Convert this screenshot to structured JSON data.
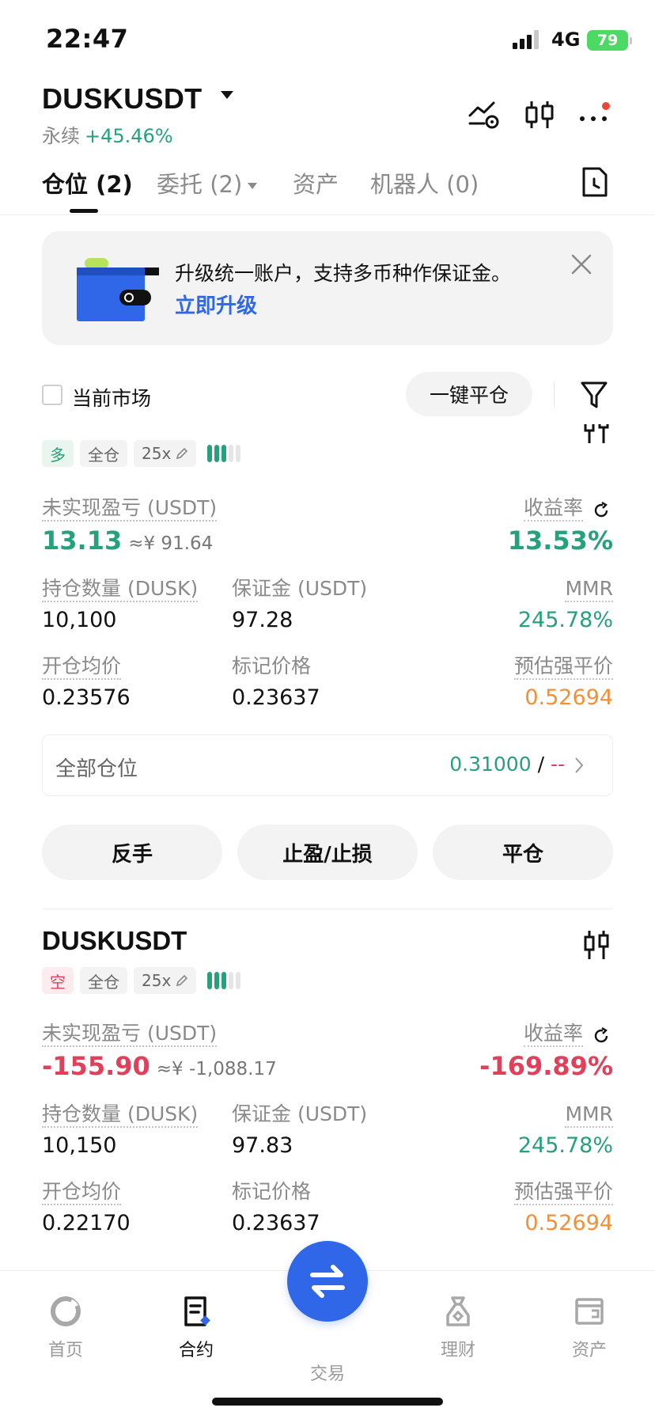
{
  "status_bar": {
    "time": "22:47",
    "network": "4G",
    "battery": "79"
  },
  "header": {
    "pair": "DUSKUSDT",
    "type": "永续",
    "change": "+45.46%"
  },
  "tabs": [
    {
      "label": "仓位 (2)"
    },
    {
      "label": "委托 (2)"
    },
    {
      "label": "资产"
    },
    {
      "label": "机器人 (0)"
    }
  ],
  "banner": {
    "text": "升级统一账户，支持多币种作保证金。",
    "link": "立即升级"
  },
  "filter": {
    "current_market": "当前市场",
    "close_all": "一键平仓"
  },
  "labels": {
    "unrealized": "未实现盈亏 (USDT)",
    "roi": "收益率",
    "size": "持仓数量 (DUSK)",
    "margin": "保证金 (USDT)",
    "mmr": "MMR",
    "entry": "开仓均价",
    "mark": "标记价格",
    "liq": "预估强平价"
  },
  "positions": [
    {
      "title": "",
      "side": "多",
      "mode": "全仓",
      "leverage": "25x",
      "pnl": "13.13",
      "pnl_cny": "≈¥ 91.64",
      "roi": "13.53%",
      "size": "10,100",
      "margin": "97.28",
      "mmr": "245.78%",
      "entry": "0.23576",
      "mark": "0.23637",
      "liq": "0.52694"
    },
    {
      "title": "DUSKUSDT",
      "side": "空",
      "mode": "全仓",
      "leverage": "25x",
      "pnl": "-155.90",
      "pnl_cny": "≈¥ -1,088.17",
      "roi": "-169.89%",
      "size": "10,150",
      "margin": "97.83",
      "mmr": "245.78%",
      "entry": "0.22170",
      "mark": "0.23637",
      "liq": "0.52694"
    }
  ],
  "all_positions": {
    "label": "全部仓位",
    "value": "0.31000",
    "slash": "/",
    "dash": "--"
  },
  "actions": {
    "reverse": "反手",
    "tpsl": "止盈/止损",
    "close": "平仓"
  },
  "nav": [
    {
      "label": "首页",
      "icon": "home-icon"
    },
    {
      "label": "合约",
      "icon": "contract-icon"
    },
    {
      "label": "交易",
      "icon": "trade-icon"
    },
    {
      "label": "理财",
      "icon": "earn-icon"
    },
    {
      "label": "资产",
      "icon": "wallet-icon"
    }
  ],
  "colors": {
    "green": "#26a17b",
    "red": "#e0405a",
    "orange": "#f0913a",
    "blue": "#2f67e8"
  }
}
